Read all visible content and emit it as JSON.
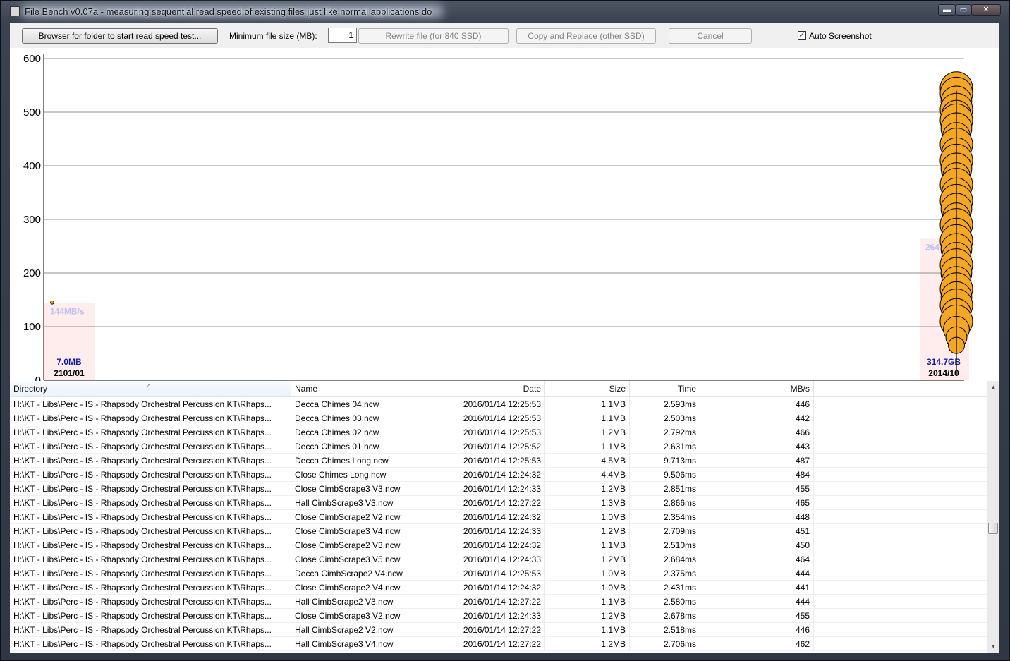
{
  "window": {
    "title": "File Bench v0.07a - measuring sequential read speed of existing files just like normal applications do",
    "min_glyph": "▬",
    "max_glyph": "▭",
    "close_glyph": "✕"
  },
  "toolbar": {
    "browse_label": "Browser for folder to start read speed test...",
    "min_size_label": "Minimum file size (MB):",
    "min_size_value": "1",
    "rewrite_label": "Rewrite file (for 840 SSD)",
    "copy_replace_label": "Copy and Replace (other SSD)",
    "cancel_label": "Cancel",
    "auto_screenshot_label": "Auto Screenshot",
    "auto_screenshot_checked": true,
    "check_glyph": "✓"
  },
  "chart_data": {
    "type": "scatter",
    "ylim": [
      0,
      600
    ],
    "y_ticks": [
      "0",
      "100",
      "200",
      "300",
      "400",
      "500",
      "600"
    ],
    "grid": true,
    "annotations": [
      {
        "group": "left",
        "speed": "144MB/s",
        "speed_value": 144,
        "size": "7.0MB",
        "date": "2101/01"
      },
      {
        "group": "right",
        "speed": "264",
        "speed_value": 264,
        "size": "314.7GB",
        "date": "2014/10"
      }
    ],
    "points": [
      {
        "group": "left",
        "y": 145,
        "r": 0.6
      },
      {
        "group": "right",
        "y": 545,
        "r": 1
      },
      {
        "group": "right",
        "y": 535,
        "r": 1
      },
      {
        "group": "right",
        "y": 520,
        "r": 0.95
      },
      {
        "group": "right",
        "y": 505,
        "r": 1
      },
      {
        "group": "right",
        "y": 495,
        "r": 0.9
      },
      {
        "group": "right",
        "y": 485,
        "r": 1
      },
      {
        "group": "right",
        "y": 470,
        "r": 0.95
      },
      {
        "group": "right",
        "y": 455,
        "r": 0.85
      },
      {
        "group": "right",
        "y": 440,
        "r": 1
      },
      {
        "group": "right",
        "y": 425,
        "r": 0.9
      },
      {
        "group": "right",
        "y": 410,
        "r": 1
      },
      {
        "group": "right",
        "y": 395,
        "r": 0.95
      },
      {
        "group": "right",
        "y": 380,
        "r": 0.85
      },
      {
        "group": "right",
        "y": 365,
        "r": 1
      },
      {
        "group": "right",
        "y": 350,
        "r": 0.9
      },
      {
        "group": "right",
        "y": 335,
        "r": 1
      },
      {
        "group": "right",
        "y": 320,
        "r": 0.95
      },
      {
        "group": "right",
        "y": 305,
        "r": 0.85
      },
      {
        "group": "right",
        "y": 290,
        "r": 1
      },
      {
        "group": "right",
        "y": 275,
        "r": 0.9
      },
      {
        "group": "right",
        "y": 260,
        "r": 1
      },
      {
        "group": "right",
        "y": 245,
        "r": 0.95
      },
      {
        "group": "right",
        "y": 230,
        "r": 0.9
      },
      {
        "group": "right",
        "y": 215,
        "r": 1
      },
      {
        "group": "right",
        "y": 200,
        "r": 0.95
      },
      {
        "group": "right",
        "y": 185,
        "r": 0.9
      },
      {
        "group": "right",
        "y": 170,
        "r": 1
      },
      {
        "group": "right",
        "y": 155,
        "r": 0.95
      },
      {
        "group": "right",
        "y": 140,
        "r": 1
      },
      {
        "group": "right",
        "y": 125,
        "r": 0.9
      },
      {
        "group": "right",
        "y": 110,
        "r": 1
      },
      {
        "group": "right",
        "y": 95,
        "r": 0.8
      },
      {
        "group": "right",
        "y": 80,
        "r": 0.65
      },
      {
        "group": "right",
        "y": 65,
        "r": 0.5
      }
    ],
    "colors": {
      "point_fill": "#f5a623",
      "point_stroke": "#000000",
      "band_fill": "#ffecec",
      "grid": "#909090"
    }
  },
  "table": {
    "columns": [
      "Directory",
      "Name",
      "Date",
      "Size",
      "Time",
      "MB/s"
    ],
    "sort_indicator": "^",
    "rows": [
      [
        "H:\\KT - Libs\\Perc - IS - Rhapsody Orchestral Percussion KT\\Rhaps...",
        "Decca Chimes 04.ncw",
        "2016/01/14 12:25:53",
        "1.1MB",
        "2.593ms",
        "446"
      ],
      [
        "H:\\KT - Libs\\Perc - IS - Rhapsody Orchestral Percussion KT\\Rhaps...",
        "Decca Chimes 03.ncw",
        "2016/01/14 12:25:53",
        "1.1MB",
        "2.503ms",
        "442"
      ],
      [
        "H:\\KT - Libs\\Perc - IS - Rhapsody Orchestral Percussion KT\\Rhaps...",
        "Decca Chimes 02.ncw",
        "2016/01/14 12:25:53",
        "1.2MB",
        "2.792ms",
        "466"
      ],
      [
        "H:\\KT - Libs\\Perc - IS - Rhapsody Orchestral Percussion KT\\Rhaps...",
        "Decca Chimes 01.ncw",
        "2016/01/14 12:25:52",
        "1.1MB",
        "2.631ms",
        "443"
      ],
      [
        "H:\\KT - Libs\\Perc - IS - Rhapsody Orchestral Percussion KT\\Rhaps...",
        "Decca Chimes Long.ncw",
        "2016/01/14 12:25:53",
        "4.5MB",
        "9.713ms",
        "487"
      ],
      [
        "H:\\KT - Libs\\Perc - IS - Rhapsody Orchestral Percussion KT\\Rhaps...",
        "Close Chimes Long.ncw",
        "2016/01/14 12:24:32",
        "4.4MB",
        "9.506ms",
        "484"
      ],
      [
        "H:\\KT - Libs\\Perc - IS - Rhapsody Orchestral Percussion KT\\Rhaps...",
        "Close CimbScrape3 V3.ncw",
        "2016/01/14 12:24:33",
        "1.2MB",
        "2.851ms",
        "455"
      ],
      [
        "H:\\KT - Libs\\Perc - IS - Rhapsody Orchestral Percussion KT\\Rhaps...",
        "Hall CimbScrape3 V3.ncw",
        "2016/01/14 12:27:22",
        "1.3MB",
        "2.866ms",
        "465"
      ],
      [
        "H:\\KT - Libs\\Perc - IS - Rhapsody Orchestral Percussion KT\\Rhaps...",
        "Close CimbScrape2 V2.ncw",
        "2016/01/14 12:24:32",
        "1.0MB",
        "2.354ms",
        "448"
      ],
      [
        "H:\\KT - Libs\\Perc - IS - Rhapsody Orchestral Percussion KT\\Rhaps...",
        "Close CimbScrape3 V4.ncw",
        "2016/01/14 12:24:33",
        "1.2MB",
        "2.709ms",
        "451"
      ],
      [
        "H:\\KT - Libs\\Perc - IS - Rhapsody Orchestral Percussion KT\\Rhaps...",
        "Close CimbScrape2 V3.ncw",
        "2016/01/14 12:24:32",
        "1.1MB",
        "2.510ms",
        "450"
      ],
      [
        "H:\\KT - Libs\\Perc - IS - Rhapsody Orchestral Percussion KT\\Rhaps...",
        "Close CimbScrape3 V5.ncw",
        "2016/01/14 12:24:33",
        "1.2MB",
        "2.684ms",
        "464"
      ],
      [
        "H:\\KT - Libs\\Perc - IS - Rhapsody Orchestral Percussion KT\\Rhaps...",
        "Decca CimbScrape2 V4.ncw",
        "2016/01/14 12:25:53",
        "1.0MB",
        "2.375ms",
        "444"
      ],
      [
        "H:\\KT - Libs\\Perc - IS - Rhapsody Orchestral Percussion KT\\Rhaps...",
        "Close CimbScrape2 V4.ncw",
        "2016/01/14 12:24:32",
        "1.0MB",
        "2.431ms",
        "441"
      ],
      [
        "H:\\KT - Libs\\Perc - IS - Rhapsody Orchestral Percussion KT\\Rhaps...",
        "Hall CimbScrape2 V3.ncw",
        "2016/01/14 12:27:22",
        "1.1MB",
        "2.580ms",
        "444"
      ],
      [
        "H:\\KT - Libs\\Perc - IS - Rhapsody Orchestral Percussion KT\\Rhaps...",
        "Close CimbScrape3 V2.ncw",
        "2016/01/14 12:24:33",
        "1.2MB",
        "2.678ms",
        "455"
      ],
      [
        "H:\\KT - Libs\\Perc - IS - Rhapsody Orchestral Percussion KT\\Rhaps...",
        "Hall CimbScrape2 V2.ncw",
        "2016/01/14 12:27:22",
        "1.1MB",
        "2.518ms",
        "446"
      ],
      [
        "H:\\KT - Libs\\Perc - IS - Rhapsody Orchestral Percussion KT\\Rhaps...",
        "Hall CimbScrape3 V4.ncw",
        "2016/01/14 12:27:22",
        "1.2MB",
        "2.706ms",
        "462"
      ]
    ]
  },
  "scrollbar": {
    "up_glyph": "▲",
    "down_glyph": "▼"
  }
}
